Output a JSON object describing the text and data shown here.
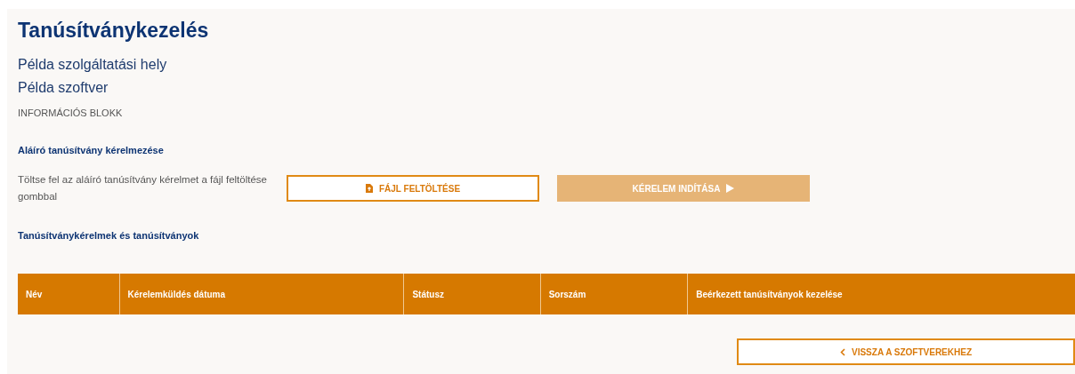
{
  "page_title": "Tanúsítványkezelés",
  "subtitles": [
    "Példa szolgáltatási hely",
    "Példa szoftver"
  ],
  "info_label": "INFORMÁCIÓS BLOKK",
  "request_section": {
    "heading": "Aláíró tanúsítvány kérelmezése",
    "description": "Töltse fel az aláíró tanúsítvány kérelmet a fájl feltöltése gombbal",
    "buttons": [
      {
        "kind": "upload",
        "label": "FÁJL FELTÖLTÉSE",
        "disabled": false
      },
      {
        "kind": "start",
        "label": "KÉRELEM INDÍTÁSA",
        "disabled": true
      }
    ]
  },
  "table": {
    "heading": "Tanúsítványkérelmek és tanúsítványok",
    "columns": [
      "Név",
      "Kérelemküldés dátuma",
      "Státusz",
      "Sorszám",
      "Beérkezett tanúsítványok kezelése"
    ]
  },
  "back_button": {
    "label": "VISSZA A SZOFTVEREKHEZ"
  }
}
